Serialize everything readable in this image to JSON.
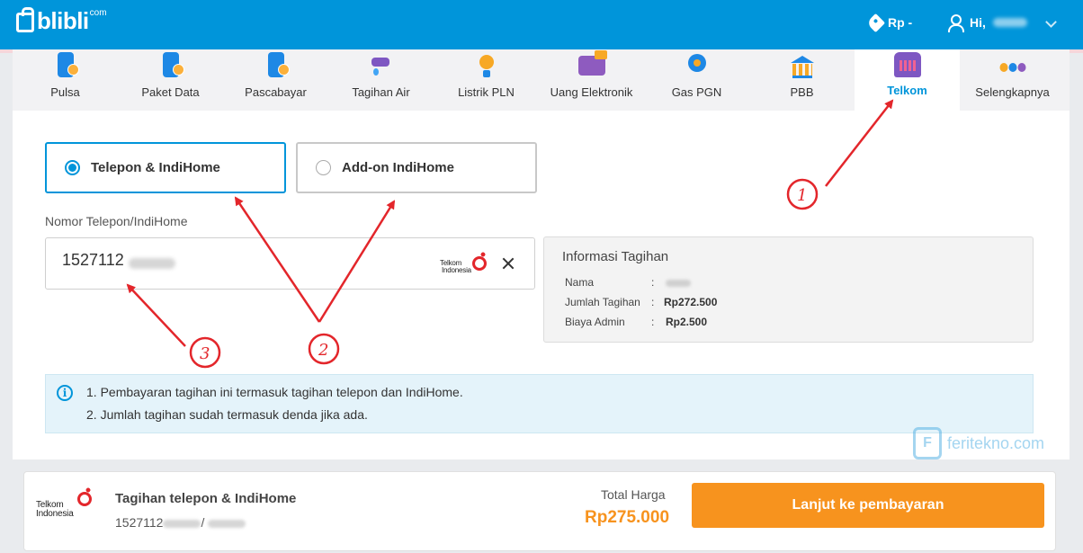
{
  "header": {
    "brand": "blibli",
    "brand_suffix": "com",
    "currency": "Rp -",
    "greeting": "Hi,"
  },
  "categories": [
    {
      "label": "Pulsa",
      "icon": "phone-icon"
    },
    {
      "label": "Paket Data",
      "icon": "phone-data-icon"
    },
    {
      "label": "Pascabayar",
      "icon": "phone-postpaid-icon"
    },
    {
      "label": "Tagihan Air",
      "icon": "water-tap-icon"
    },
    {
      "label": "Listrik PLN",
      "icon": "lightbulb-icon"
    },
    {
      "label": "Uang Elektronik",
      "icon": "wallet-icon"
    },
    {
      "label": "Gas PGN",
      "icon": "gas-icon"
    },
    {
      "label": "PBB",
      "icon": "bank-building-icon"
    },
    {
      "label": "Telkom",
      "icon": "telkom-icon",
      "active": true
    },
    {
      "label": "Selengkapnya",
      "icon": "more-dots-icon"
    }
  ],
  "options": {
    "option1": "Telepon & IndiHome",
    "option2": "Add-on IndiHome",
    "selected": "option1"
  },
  "phone_field": {
    "label": "Nomor Telepon/IndiHome",
    "value": "1527112"
  },
  "provider_logo": {
    "line1": "Telkom",
    "line2": "Indonesia"
  },
  "billing": {
    "title": "Informasi Tagihan",
    "rows": [
      {
        "key": "Nama",
        "value": ""
      },
      {
        "key": "Jumlah Tagihan",
        "value": "Rp272.500"
      },
      {
        "key": "Biaya Admin",
        "value": "Rp2.500"
      }
    ]
  },
  "notice": {
    "line1": "1. Pembayaran tagihan ini termasuk tagihan telepon dan IndiHome.",
    "line2": "2. Jumlah tagihan sudah termasuk denda jika ada."
  },
  "watermark": "feritekno.com",
  "footer": {
    "title": "Tagihan telepon & IndiHome",
    "number": "1527112",
    "separator": "/",
    "total_label": "Total Harga",
    "total_value": "Rp275.000",
    "pay_button": "Lanjut ke pembayaran"
  },
  "annotations": [
    "1",
    "2",
    "3"
  ],
  "colors": {
    "primary": "#0095da",
    "accent": "#f7931e",
    "annotation": "#e3262b"
  }
}
